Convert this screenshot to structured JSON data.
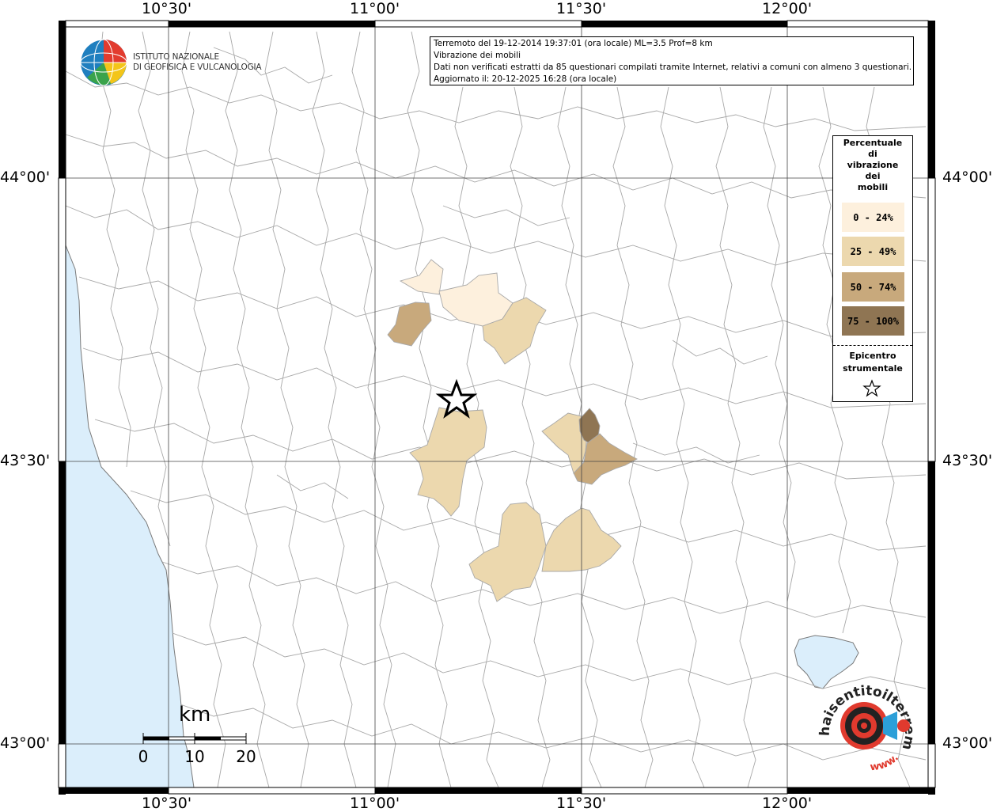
{
  "map": {
    "x_ticks": [
      "10°30'",
      "11°00'",
      "11°30'",
      "12°00'"
    ],
    "y_ticks": [
      "44°00'",
      "43°30'",
      "43°00'"
    ],
    "sea_color": "#dbeefb",
    "land_color": "#ffffff",
    "border_color": "#9a9a9a"
  },
  "info_box": {
    "line1": "Terremoto del 19-12-2014 19:37:01 (ora locale) ML=3.5 Prof=8 km",
    "line2": "Vibrazione dei mobili",
    "line3": "Dati non verificati estratti da 85 questionari compilati tramite Internet, relativi a comuni con almeno 3 questionari.",
    "line4": "Aggiornato il: 20-12-2025 16:28 (ora locale)"
  },
  "institute_logo": {
    "line1": "ISTITUTO NAZIONALE",
    "line2": "DI GEOFISICA E VULCANOLOGIA"
  },
  "legend": {
    "title": [
      "Percentuale",
      "di",
      "vibrazione",
      "dei",
      "mobili"
    ],
    "classes": [
      {
        "label": "0 - 24%",
        "color": "#fdf0dd"
      },
      {
        "label": "25 - 49%",
        "color": "#ecd8ae"
      },
      {
        "label": "50 - 74%",
        "color": "#c8a97c"
      },
      {
        "label": "75 - 100%",
        "color": "#8f7553"
      }
    ],
    "epicenter_label": [
      "Epicentro",
      "strumentale"
    ]
  },
  "scale_bar": {
    "unit": "km",
    "ticks": [
      "0",
      "10",
      "20"
    ]
  },
  "hst_logo": {
    "text": "haisentitoilterremoto.it",
    "www": "www."
  }
}
